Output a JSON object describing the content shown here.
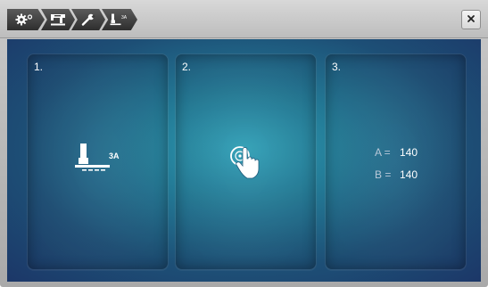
{
  "toolbar": {
    "breadcrumbs": [
      {
        "icon": "settings-gear-icon"
      },
      {
        "icon": "sewing-machine-icon"
      },
      {
        "icon": "wrench-icon"
      },
      {
        "icon": "presser-foot-icon",
        "badge": "3A"
      }
    ],
    "close_label": "×"
  },
  "steps": [
    {
      "number": "1.",
      "icon": "presser-foot-icon",
      "foot_label": "3A"
    },
    {
      "number": "2.",
      "icon": "touch-screen-icon"
    },
    {
      "number": "3.",
      "values": [
        {
          "label": "A =",
          "value": "140"
        },
        {
          "label": "B =",
          "value": "140"
        }
      ]
    }
  ]
}
